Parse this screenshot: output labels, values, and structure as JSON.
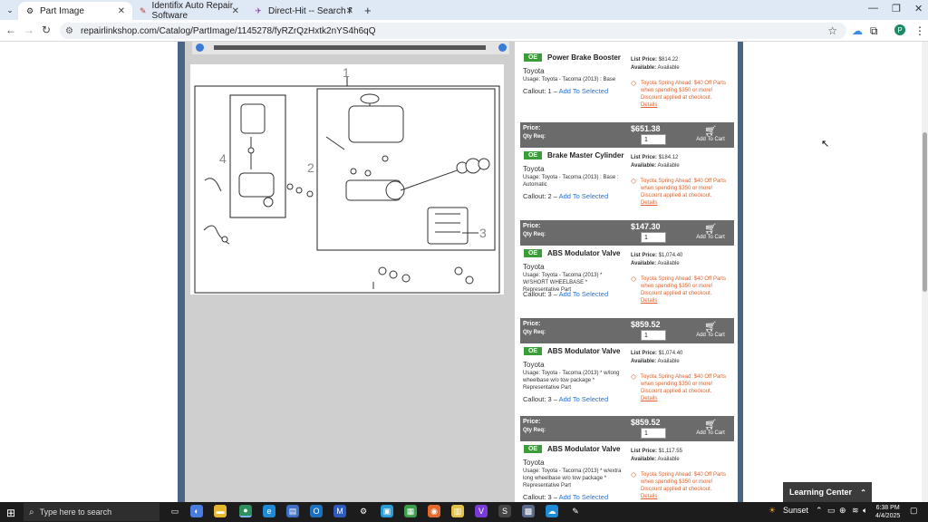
{
  "browser": {
    "tabs": [
      {
        "label": "Part Image",
        "icon": "gear-icon",
        "active": true
      },
      {
        "label": "Identifix Auto Repair Software",
        "icon": "identifix-icon",
        "active": false
      },
      {
        "label": "Direct-Hit -- Search Fixes|Infor",
        "icon": "direct-hit-icon",
        "active": false
      }
    ],
    "url": "repairlinkshop.com/Catalog/PartImage/1145278/fyRZrQzHxtk2nYS4h6qQ",
    "profile_initial": "P"
  },
  "diagram": {
    "callouts": [
      "1",
      "2",
      "3",
      "4"
    ]
  },
  "parts": [
    {
      "badge": "OE",
      "name": "Power Brake Booster",
      "brand": "Toyota",
      "usage": "Usage: Toyota - Tacoma (2013) : Base",
      "callout_prefix": "Callout: 1 –",
      "callout_link": "Add To Selected",
      "list_price_label": "List Price:",
      "list_price": "$814.22",
      "available_label": "Available:",
      "available": "Available",
      "promo": "Toyota Spring Ahead: $40 Off Parts when spending $350 or more! Discount applied at checkout.",
      "details": "Details",
      "price_label": "Price:",
      "price": "$651.38",
      "qty_label": "Qty Req:",
      "qty": "1",
      "cart": "Add To Cart"
    },
    {
      "badge": "OE",
      "name": "Brake Master Cylinder",
      "brand": "Toyota",
      "usage": "Usage: Toyota - Tacoma (2013) : Base : Automatic",
      "callout_prefix": "Callout: 2 –",
      "callout_link": "Add To Selected",
      "list_price_label": "List Price:",
      "list_price": "$184.12",
      "available_label": "Available:",
      "available": "Available",
      "promo": "Toyota Spring Ahead: $40 Off Parts when spending $350 or more! Discount applied at checkout.",
      "details": "Details",
      "price_label": "Price:",
      "price": "$147.30",
      "qty_label": "Qty Req:",
      "qty": "1",
      "cart": "Add To Cart"
    },
    {
      "badge": "OE",
      "name": "ABS Modulator Valve",
      "brand": "Toyota",
      "usage": "Usage: Toyota - Tacoma (2013) * W/SHORT WHEELBASE * Representative Part",
      "callout_prefix": "Callout: 3 –",
      "callout_link": "Add To Selected",
      "list_price_label": "List Price:",
      "list_price": "$1,074.40",
      "available_label": "Available:",
      "available": "Available",
      "promo": "Toyota Spring Ahead: $40 Off Parts when spending $350 or more! Discount applied at checkout.",
      "details": "Details",
      "price_label": "Price:",
      "price": "$859.52",
      "qty_label": "Qty Req:",
      "qty": "1",
      "cart": "Add To Cart"
    },
    {
      "badge": "OE",
      "name": "ABS Modulator Valve",
      "brand": "Toyota",
      "usage": "Usage: Toyota - Tacoma (2013) * w/long wheelbase w/o tow package * Representative Part",
      "callout_prefix": "Callout: 3 –",
      "callout_link": "Add To Selected",
      "list_price_label": "List Price:",
      "list_price": "$1,074.40",
      "available_label": "Available:",
      "available": "Available",
      "promo": "Toyota Spring Ahead: $40 Off Parts when spending $350 or more! Discount applied at checkout.",
      "details": "Details",
      "price_label": "Price:",
      "price": "$859.52",
      "qty_label": "Qty Req:",
      "qty": "1",
      "cart": "Add To Cart"
    },
    {
      "badge": "OE",
      "name": "ABS Modulator Valve",
      "brand": "Toyota",
      "usage": "Usage: Toyota - Tacoma (2013) * w/extra long wheelbase w/o tow package * Representative Part",
      "callout_prefix": "Callout: 3 –",
      "callout_link": "Add To Selected",
      "list_price_label": "List Price:",
      "list_price": "$1,117.55",
      "available_label": "Available:",
      "available": "Available",
      "promo": "Toyota Spring Ahead: $40 Off Parts when spending $350 or more! Discount applied at checkout.",
      "details": "Details"
    }
  ],
  "learning_center": "Learning Center",
  "taskbar": {
    "search_placeholder": "Type here to search",
    "weather": "Sunset",
    "time": "6:38 PM",
    "date": "4/4/2025"
  }
}
